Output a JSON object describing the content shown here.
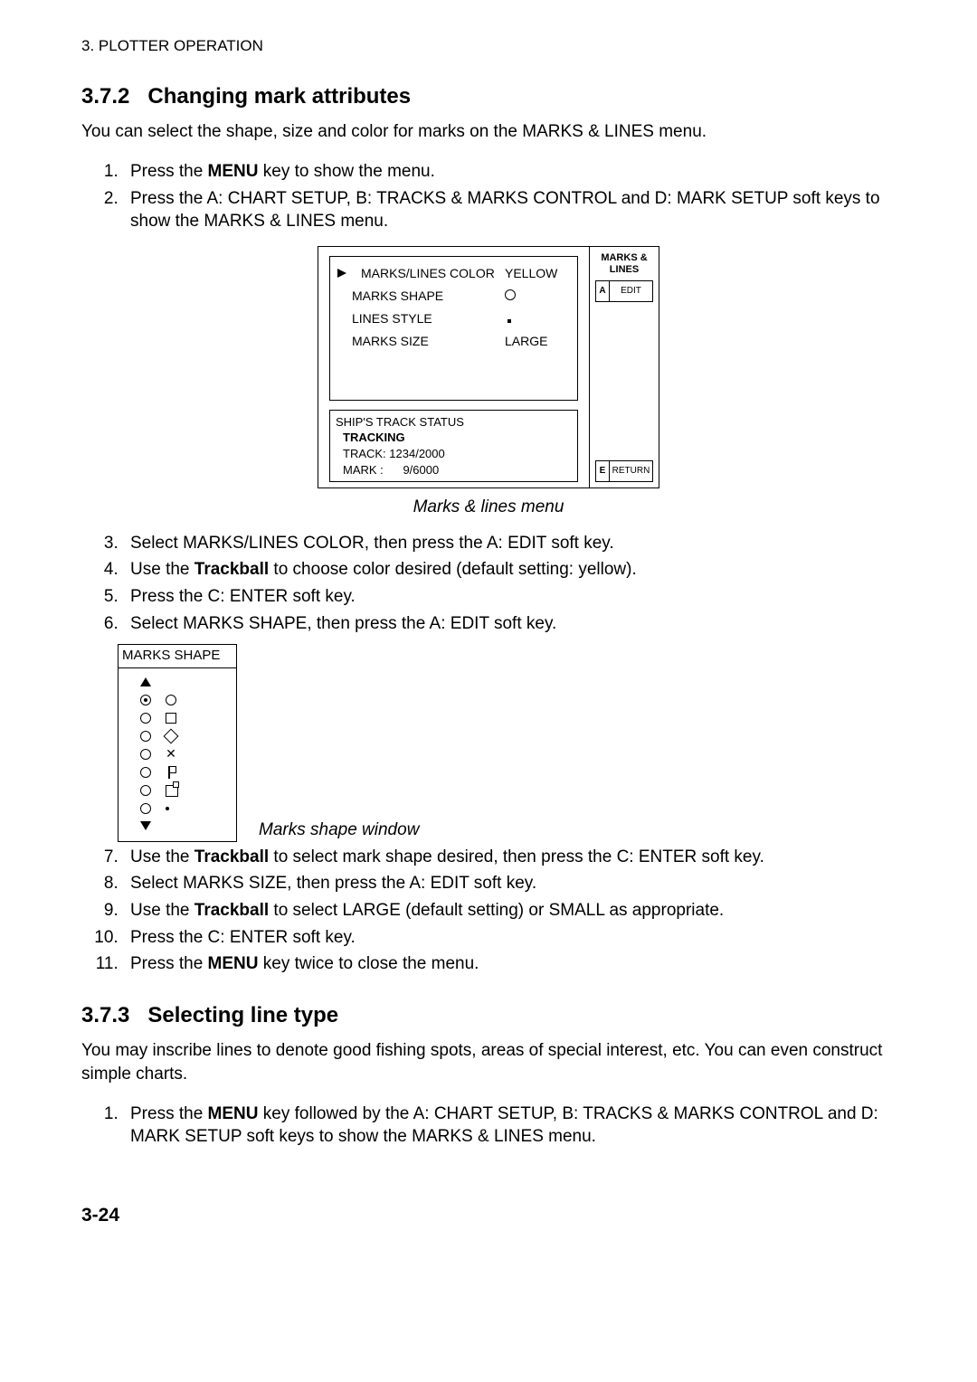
{
  "header": "3. PLOTTER OPERATION",
  "section1": {
    "num": "3.7.2",
    "title": "Changing mark attributes",
    "intro": "You can select the shape, size and color for marks on the MARKS & LINES menu.",
    "step1_a": "Press the ",
    "step1_key": "MENU",
    "step1_b": " key to show the menu.",
    "step2": "Press the A: CHART SETUP, B: TRACKS & MARKS CONTROL and D: MARK SETUP soft keys to show the MARKS & LINES menu."
  },
  "menu": {
    "rows": {
      "r1l": "MARKS/LINES COLOR",
      "r1v": "YELLOW",
      "r2l": "MARKS SHAPE",
      "r3l": "LINES STYLE",
      "r4l": "MARKS SIZE",
      "r4v": "LARGE"
    },
    "status_t": "SHIP'S TRACK STATUS",
    "status_mode": "TRACKING",
    "status_track": "TRACK: 1234/2000",
    "status_mark": "MARK :      9/6000",
    "side_title1": "MARKS &",
    "side_title2": "LINES",
    "skA_l": "A",
    "skA_t": "EDIT",
    "skE_l": "E",
    "skE_t": "RETURN"
  },
  "fig1_caption": "Marks & lines menu",
  "steps2": {
    "s3": "Select MARKS/LINES COLOR, then press the A: EDIT soft key.",
    "s4a": "Use the ",
    "s4key": "Trackball",
    "s4b": " to choose color desired (default setting: yellow).",
    "s5": "Press the C: ENTER soft key.",
    "s6": "Select MARKS SHAPE, then press the A: EDIT soft key."
  },
  "shape_title": "MARKS SHAPE",
  "fig2_caption": "Marks shape window",
  "steps3": {
    "s7a": "Use the ",
    "s7key": "Trackball",
    "s7b": " to select mark shape desired, then press the C: ENTER soft key.",
    "s8": "Select MARKS SIZE, then press the A: EDIT soft key.",
    "s9a": "Use the ",
    "s9key": "Trackball",
    "s9b": " to select LARGE (default setting) or SMALL as appropriate.",
    "s10": "Press the C: ENTER soft key.",
    "s11a": "Press the ",
    "s11key": "MENU",
    "s11b": " key twice to close the menu."
  },
  "section2": {
    "num": "3.7.3",
    "title": "Selecting line type",
    "intro": "You may inscribe lines to denote good fishing spots, areas of special interest, etc. You can even construct simple charts.",
    "s1a": "Press the ",
    "s1key": "MENU",
    "s1b": " key followed by the A: CHART SETUP, B: TRACKS & MARKS CONTROL and D: MARK SETUP soft keys to show the MARKS & LINES menu."
  },
  "page_num": "3-24"
}
